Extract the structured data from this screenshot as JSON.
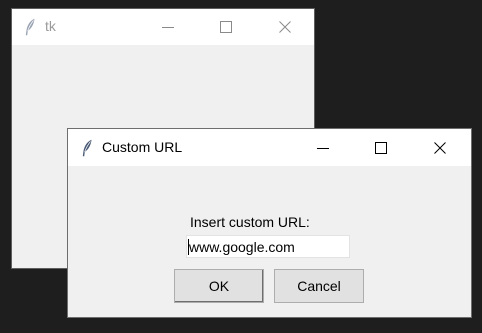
{
  "root_window": {
    "title": "tk",
    "icon": "feather-icon",
    "controls": [
      "minimize-icon",
      "maximize-icon",
      "close-icon"
    ]
  },
  "dialog": {
    "title": "Custom URL",
    "icon": "feather-icon",
    "controls": [
      "minimize-icon",
      "maximize-icon",
      "close-icon"
    ],
    "prompt_label": "Insert custom URL:",
    "url_value": "www.google.com",
    "ok_label": "OK",
    "cancel_label": "Cancel"
  },
  "colors": {
    "desktop": "#1e1e1e",
    "titlebar": "#ffffff",
    "client": "#f0f0f0",
    "button_face": "#e1e1e1",
    "inactive_title_text": "#9a9a9a"
  }
}
